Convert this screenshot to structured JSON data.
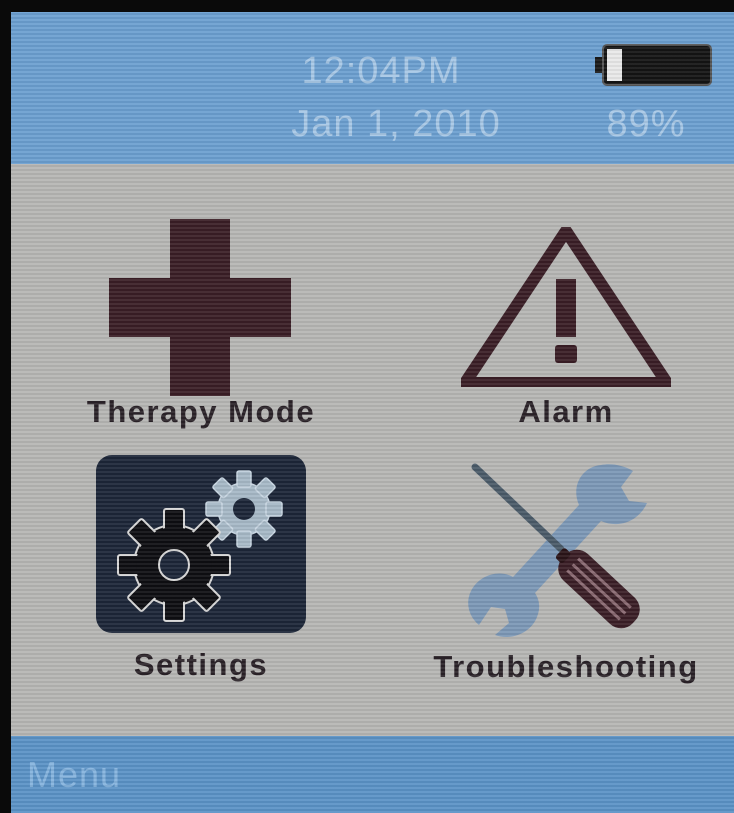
{
  "status_bar": {
    "time": "12:04PM",
    "date": "Jan 1, 2010",
    "battery_percent": "89%",
    "battery_level": 0.15
  },
  "menu": {
    "items": [
      {
        "label": "Therapy Mode",
        "icon": "medical-cross-icon"
      },
      {
        "label": "Alarm",
        "icon": "warning-triangle-icon"
      },
      {
        "label": "Settings",
        "icon": "gears-icon"
      },
      {
        "label": "Troubleshooting",
        "icon": "wrench-screwdriver-icon"
      }
    ]
  },
  "footer": {
    "title": "Menu"
  },
  "colors": {
    "header_bar": "#6c9fd0",
    "footer_bar": "#5b92c6",
    "text_on_bar": "#a8c8e6",
    "panel": "#b6b6b4",
    "icon_dark": "#3a1e26",
    "settings_tile": "#1c2638",
    "gear_light": "#a6b8c6",
    "tool_blue": "#7c98b6"
  }
}
